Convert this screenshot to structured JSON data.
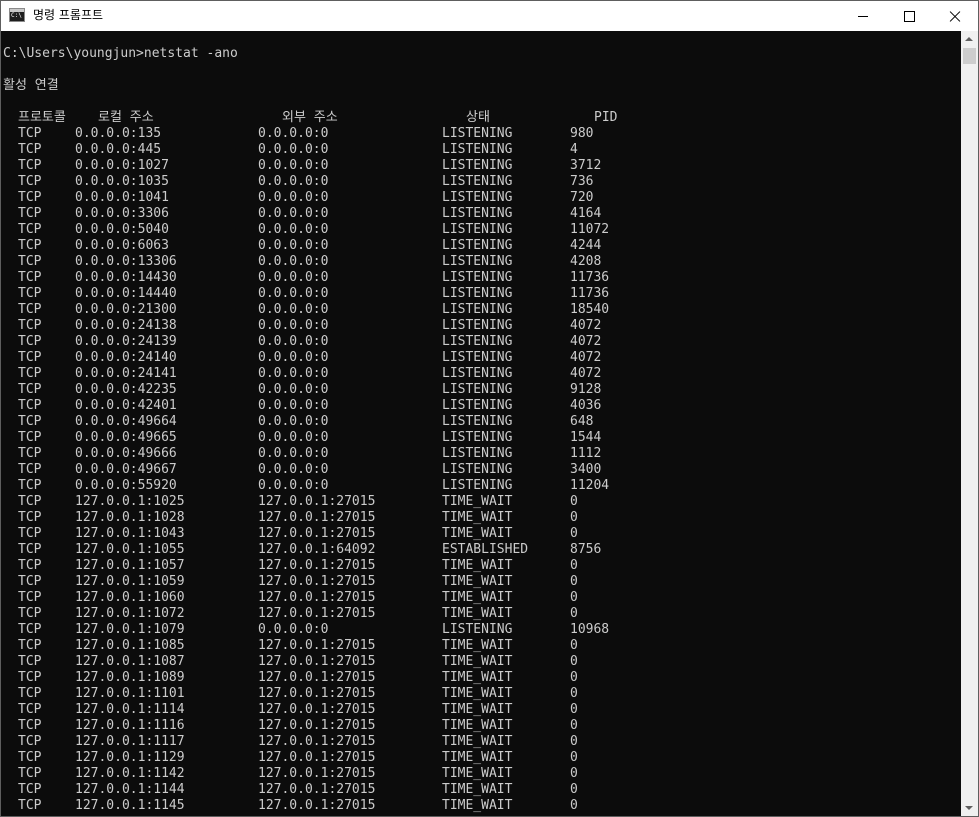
{
  "window": {
    "title": "명령 프롬프트"
  },
  "console": {
    "command_line": "C:\\Users\\youngjun>netstat -ano",
    "section_title": "활성 연결",
    "headers": {
      "proto": "프로토콜",
      "local": "로컬 주소",
      "foreign": "외부 주소",
      "state": "상태",
      "pid": "PID"
    },
    "rows": [
      [
        "TCP",
        "0.0.0.0:135",
        "0.0.0.0:0",
        "LISTENING",
        "980"
      ],
      [
        "TCP",
        "0.0.0.0:445",
        "0.0.0.0:0",
        "LISTENING",
        "4"
      ],
      [
        "TCP",
        "0.0.0.0:1027",
        "0.0.0.0:0",
        "LISTENING",
        "3712"
      ],
      [
        "TCP",
        "0.0.0.0:1035",
        "0.0.0.0:0",
        "LISTENING",
        "736"
      ],
      [
        "TCP",
        "0.0.0.0:1041",
        "0.0.0.0:0",
        "LISTENING",
        "720"
      ],
      [
        "TCP",
        "0.0.0.0:3306",
        "0.0.0.0:0",
        "LISTENING",
        "4164"
      ],
      [
        "TCP",
        "0.0.0.0:5040",
        "0.0.0.0:0",
        "LISTENING",
        "11072"
      ],
      [
        "TCP",
        "0.0.0.0:6063",
        "0.0.0.0:0",
        "LISTENING",
        "4244"
      ],
      [
        "TCP",
        "0.0.0.0:13306",
        "0.0.0.0:0",
        "LISTENING",
        "4208"
      ],
      [
        "TCP",
        "0.0.0.0:14430",
        "0.0.0.0:0",
        "LISTENING",
        "11736"
      ],
      [
        "TCP",
        "0.0.0.0:14440",
        "0.0.0.0:0",
        "LISTENING",
        "11736"
      ],
      [
        "TCP",
        "0.0.0.0:21300",
        "0.0.0.0:0",
        "LISTENING",
        "18540"
      ],
      [
        "TCP",
        "0.0.0.0:24138",
        "0.0.0.0:0",
        "LISTENING",
        "4072"
      ],
      [
        "TCP",
        "0.0.0.0:24139",
        "0.0.0.0:0",
        "LISTENING",
        "4072"
      ],
      [
        "TCP",
        "0.0.0.0:24140",
        "0.0.0.0:0",
        "LISTENING",
        "4072"
      ],
      [
        "TCP",
        "0.0.0.0:24141",
        "0.0.0.0:0",
        "LISTENING",
        "4072"
      ],
      [
        "TCP",
        "0.0.0.0:42235",
        "0.0.0.0:0",
        "LISTENING",
        "9128"
      ],
      [
        "TCP",
        "0.0.0.0:42401",
        "0.0.0.0:0",
        "LISTENING",
        "4036"
      ],
      [
        "TCP",
        "0.0.0.0:49664",
        "0.0.0.0:0",
        "LISTENING",
        "648"
      ],
      [
        "TCP",
        "0.0.0.0:49665",
        "0.0.0.0:0",
        "LISTENING",
        "1544"
      ],
      [
        "TCP",
        "0.0.0.0:49666",
        "0.0.0.0:0",
        "LISTENING",
        "1112"
      ],
      [
        "TCP",
        "0.0.0.0:49667",
        "0.0.0.0:0",
        "LISTENING",
        "3400"
      ],
      [
        "TCP",
        "0.0.0.0:55920",
        "0.0.0.0:0",
        "LISTENING",
        "11204"
      ],
      [
        "TCP",
        "127.0.0.1:1025",
        "127.0.0.1:27015",
        "TIME_WAIT",
        "0"
      ],
      [
        "TCP",
        "127.0.0.1:1028",
        "127.0.0.1:27015",
        "TIME_WAIT",
        "0"
      ],
      [
        "TCP",
        "127.0.0.1:1043",
        "127.0.0.1:27015",
        "TIME_WAIT",
        "0"
      ],
      [
        "TCP",
        "127.0.0.1:1055",
        "127.0.0.1:64092",
        "ESTABLISHED",
        "8756"
      ],
      [
        "TCP",
        "127.0.0.1:1057",
        "127.0.0.1:27015",
        "TIME_WAIT",
        "0"
      ],
      [
        "TCP",
        "127.0.0.1:1059",
        "127.0.0.1:27015",
        "TIME_WAIT",
        "0"
      ],
      [
        "TCP",
        "127.0.0.1:1060",
        "127.0.0.1:27015",
        "TIME_WAIT",
        "0"
      ],
      [
        "TCP",
        "127.0.0.1:1072",
        "127.0.0.1:27015",
        "TIME_WAIT",
        "0"
      ],
      [
        "TCP",
        "127.0.0.1:1079",
        "0.0.0.0:0",
        "LISTENING",
        "10968"
      ],
      [
        "TCP",
        "127.0.0.1:1085",
        "127.0.0.1:27015",
        "TIME_WAIT",
        "0"
      ],
      [
        "TCP",
        "127.0.0.1:1087",
        "127.0.0.1:27015",
        "TIME_WAIT",
        "0"
      ],
      [
        "TCP",
        "127.0.0.1:1089",
        "127.0.0.1:27015",
        "TIME_WAIT",
        "0"
      ],
      [
        "TCP",
        "127.0.0.1:1101",
        "127.0.0.1:27015",
        "TIME_WAIT",
        "0"
      ],
      [
        "TCP",
        "127.0.0.1:1114",
        "127.0.0.1:27015",
        "TIME_WAIT",
        "0"
      ],
      [
        "TCP",
        "127.0.0.1:1116",
        "127.0.0.1:27015",
        "TIME_WAIT",
        "0"
      ],
      [
        "TCP",
        "127.0.0.1:1117",
        "127.0.0.1:27015",
        "TIME_WAIT",
        "0"
      ],
      [
        "TCP",
        "127.0.0.1:1129",
        "127.0.0.1:27015",
        "TIME_WAIT",
        "0"
      ],
      [
        "TCP",
        "127.0.0.1:1142",
        "127.0.0.1:27015",
        "TIME_WAIT",
        "0"
      ],
      [
        "TCP",
        "127.0.0.1:1144",
        "127.0.0.1:27015",
        "TIME_WAIT",
        "0"
      ],
      [
        "TCP",
        "127.0.0.1:1145",
        "127.0.0.1:27015",
        "TIME_WAIT",
        "0"
      ]
    ]
  }
}
